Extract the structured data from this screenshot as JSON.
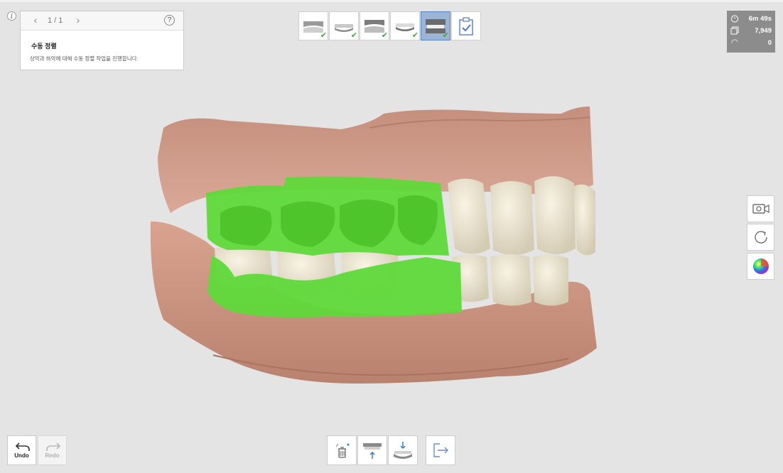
{
  "guide": {
    "page": "1 / 1",
    "prev_icon": "chevron-left-icon",
    "next_icon": "chevron-right-icon",
    "help": "?",
    "title": "수동 정렬",
    "description": "상악과 하악에 대해 수동 정렬 작업을 진행합니다.",
    "info": "i"
  },
  "stages": [
    {
      "icon": "upper-jaw-scan-icon",
      "done": true
    },
    {
      "icon": "lower-jaw-scan-icon",
      "done": true
    },
    {
      "icon": "upper-denture-scan-icon",
      "done": true
    },
    {
      "icon": "lower-denture-scan-icon",
      "done": true
    },
    {
      "icon": "occlusion-align-icon",
      "done": true,
      "active": true
    },
    {
      "icon": "review-clipboard-icon",
      "done": false
    }
  ],
  "stats": {
    "time": "6m 49s",
    "shots": "7,949",
    "rotations": "0"
  },
  "right_tools": [
    "camera-icon",
    "rotate-icon",
    "color-map-icon"
  ],
  "bottom": {
    "undo_label": "Undo",
    "redo_label": "Redo",
    "tools": [
      "cleanup-icon",
      "upper-jaw-move-icon",
      "lower-jaw-move-icon",
      "exit-icon"
    ]
  },
  "colors": {
    "accent": "#5b86c4",
    "aligned_region": "#5fd93a",
    "gum": "#d9a28e",
    "teeth": "#e8dfc9"
  }
}
